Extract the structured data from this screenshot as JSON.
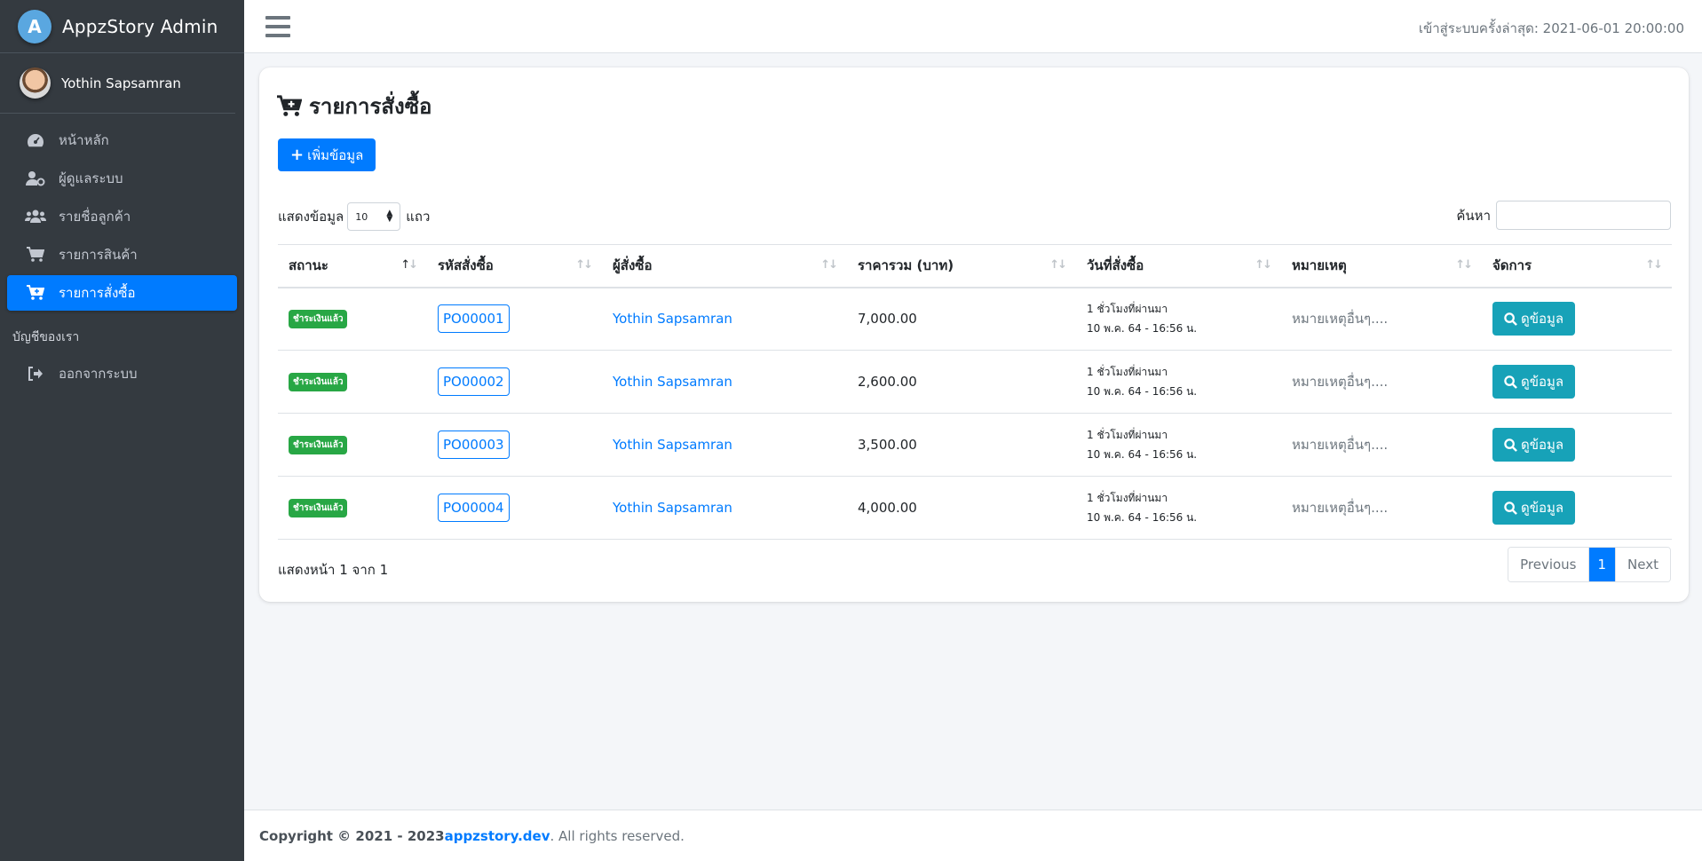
{
  "brand": {
    "name": "AppzStory Admin",
    "logo_letter": "A"
  },
  "user": {
    "name": "Yothin Sapsamran"
  },
  "sidebar": {
    "items": [
      {
        "label": "หน้าหลัก",
        "icon": "dashboard-icon",
        "active": false
      },
      {
        "label": "ผู้ดูแลระบบ",
        "icon": "user-cog-icon",
        "active": false
      },
      {
        "label": "รายชื่อลูกค้า",
        "icon": "users-icon",
        "active": false
      },
      {
        "label": "รายการสินค้า",
        "icon": "cart-icon",
        "active": false
      },
      {
        "label": "รายการสั่งซื้อ",
        "icon": "cart-plus-icon",
        "active": true
      }
    ],
    "section_header": "บัญชีของเรา",
    "logout_label": "ออกจากระบบ"
  },
  "header": {
    "last_login": "เข้าสู่ระบบครั้งล่าสุด: 2021-06-01 20:00:00"
  },
  "page": {
    "title": "รายการสั่งซื้อ",
    "add_button": "เพิ่มข้อมูล",
    "length_prefix": "แสดงข้อมูล",
    "length_value": "10",
    "length_suffix": "แถว",
    "search_label": "ค้นหา",
    "search_value": ""
  },
  "table": {
    "columns": [
      "สถานะ",
      "รหัสสั่งซื้อ",
      "ผู้สั่งซื้อ",
      "ราคารวม (บาท)",
      "วันที่สั่งซื้อ",
      "หมายเหตุ",
      "จัดการ"
    ],
    "rows": [
      {
        "status": "ชำระเงินแล้ว",
        "po": "PO00001",
        "buyer": "Yothin Sapsamran",
        "total": "7,000.00",
        "date_rel": "1 ชั่วโมงที่ผ่านมา",
        "date_abs": "10 พ.ค. 64 - 16:56 น.",
        "note": "หมายเหตุอื่นๆ....",
        "action": "ดูข้อมูล"
      },
      {
        "status": "ชำระเงินแล้ว",
        "po": "PO00002",
        "buyer": "Yothin Sapsamran",
        "total": "2,600.00",
        "date_rel": "1 ชั่วโมงที่ผ่านมา",
        "date_abs": "10 พ.ค. 64 - 16:56 น.",
        "note": "หมายเหตุอื่นๆ....",
        "action": "ดูข้อมูล"
      },
      {
        "status": "ชำระเงินแล้ว",
        "po": "PO00003",
        "buyer": "Yothin Sapsamran",
        "total": "3,500.00",
        "date_rel": "1 ชั่วโมงที่ผ่านมา",
        "date_abs": "10 พ.ค. 64 - 16:56 น.",
        "note": "หมายเหตุอื่นๆ....",
        "action": "ดูข้อมูล"
      },
      {
        "status": "ชำระเงินแล้ว",
        "po": "PO00004",
        "buyer": "Yothin Sapsamran",
        "total": "4,000.00",
        "date_rel": "1 ชั่วโมงที่ผ่านมา",
        "date_abs": "10 พ.ค. 64 - 16:56 น.",
        "note": "หมายเหตุอื่นๆ....",
        "action": "ดูข้อมูล"
      }
    ]
  },
  "pagination": {
    "info": "แสดงหน้า 1 จาก 1",
    "previous": "Previous",
    "current": "1",
    "next": "Next"
  },
  "footer": {
    "copyright": "Copyright © 2021 - 2023 ",
    "site": "appzstory.dev",
    "rights": ". All rights reserved."
  },
  "colors": {
    "primary": "#007bff",
    "info": "#17a2b8",
    "success": "#28a745",
    "sidebar_bg": "#343a40"
  }
}
